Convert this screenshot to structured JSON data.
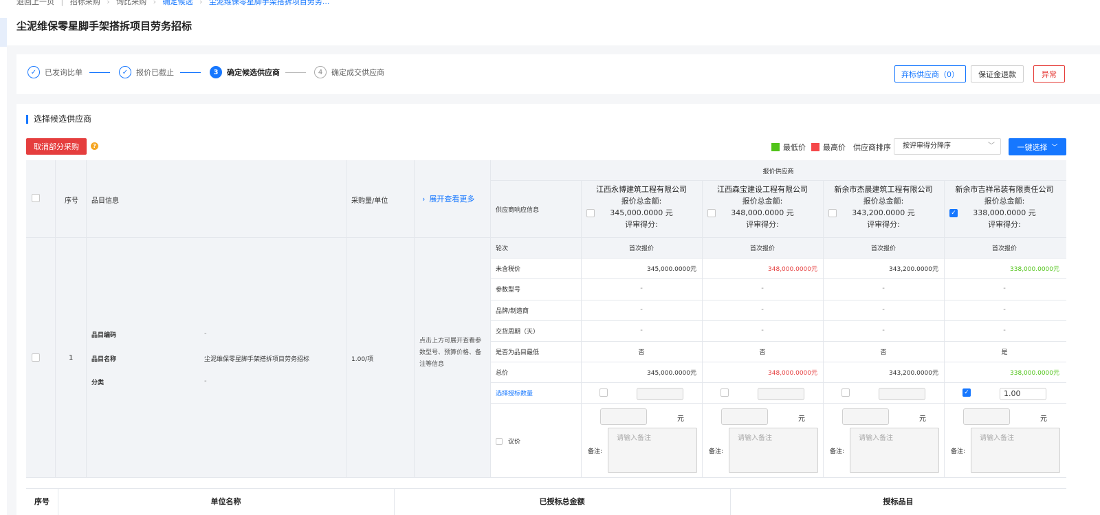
{
  "breadcrumb": {
    "back": "退回上一页",
    "items": [
      "招标采购",
      "询比采购",
      "确定候选"
    ],
    "current": "尘泥维保零星脚手架搭拆项目劳务..."
  },
  "page_title": "尘泥维保零星脚手架搭拆项目劳务招标",
  "steps": [
    {
      "num": "✓",
      "label": "已发询比单",
      "state": "done"
    },
    {
      "num": "✓",
      "label": "报价已截止",
      "state": "done"
    },
    {
      "num": "3",
      "label": "确定候选供应商",
      "state": "current"
    },
    {
      "num": "4",
      "label": "确定成交供应商",
      "state": "todo"
    }
  ],
  "top_buttons": {
    "abandon": "弃标供应商（0）",
    "deposit_refund": "保证金退款",
    "abnormal": "异常"
  },
  "section_title": "选择候选供应商",
  "cancel_partial": "取消部分采购",
  "legend": {
    "lowest": "最低价",
    "highest": "最高价",
    "sort_label": "供应商排序",
    "sort_value": "按评审得分降序",
    "low_color": "#52c41a",
    "high_color": "#f5484a"
  },
  "one_click": "一键选择",
  "table": {
    "headers": {
      "seq": "序号",
      "item_info": "品目信息",
      "qty_unit": "采购量/单位",
      "expand": "展开查看更多",
      "quote_suppliers": "报价供应商",
      "response_info": "供应商响应信息"
    },
    "suppliers": [
      {
        "name": "江西永博建筑工程有限公司",
        "total_label": "报价总金额:",
        "total": "345,000.0000 元",
        "score_label": "评审得分:",
        "checked": false,
        "round": "首次报价",
        "price": "345,000.0000元",
        "price_class": "",
        "param": "-",
        "brand": "-",
        "delivery": "-",
        "is_lowest": "否",
        "total_price": "345,000.0000元",
        "award_checked": false,
        "award_qty": "",
        "unit": "元",
        "remark_label": "备注:",
        "remark_ph": "请输入备注"
      },
      {
        "name": "江西森宝建设工程有限公司",
        "total_label": "报价总金额:",
        "total": "348,000.0000 元",
        "score_label": "评审得分:",
        "checked": false,
        "round": "首次报价",
        "price": "348,000.0000元",
        "price_class": "red",
        "param": "-",
        "brand": "-",
        "delivery": "-",
        "is_lowest": "否",
        "total_price": "348,000.0000元",
        "award_checked": false,
        "award_qty": "",
        "unit": "元",
        "remark_label": "备注:",
        "remark_ph": "请输入备注"
      },
      {
        "name": "新余市杰晨建筑工程有限公司",
        "total_label": "报价总金额:",
        "total": "343,200.0000 元",
        "score_label": "评审得分:",
        "checked": false,
        "round": "首次报价",
        "price": "343,200.0000元",
        "price_class": "",
        "param": "-",
        "brand": "-",
        "delivery": "-",
        "is_lowest": "否",
        "total_price": "343,200.0000元",
        "award_checked": false,
        "award_qty": "",
        "unit": "元",
        "remark_label": "备注:",
        "remark_ph": "请输入备注"
      },
      {
        "name": "新余市吉祥吊装有限责任公司",
        "total_label": "报价总金额:",
        "total": "338,000.0000 元",
        "score_label": "评审得分:",
        "checked": true,
        "round": "首次报价",
        "price": "338,000.0000元",
        "price_class": "green",
        "param": "-",
        "brand": "-",
        "delivery": "-",
        "is_lowest": "是",
        "total_price": "338,000.0000元",
        "award_checked": true,
        "award_qty": "1.00",
        "unit": "元",
        "remark_label": "备注:",
        "remark_ph": "请输入备注"
      }
    ],
    "row_labels": {
      "round": "轮次",
      "price": "未含税价",
      "param": "参数型号",
      "brand": "品牌/制造商",
      "delivery": "交货周期（天）",
      "is_lowest": "是否为品目最低",
      "total": "总价",
      "award_qty": "选择授标数量",
      "negotiate": "议价"
    },
    "row": {
      "seq": "1",
      "code_label": "品目编码",
      "code": "-",
      "name_label": "品目名称",
      "name": "尘泥维保零星脚手架搭拆项目劳务招标",
      "cat_label": "分类",
      "cat": "-",
      "qty": "1.00/项",
      "hint": "点击上方可展开查看参数型号、预算价格、备注等信息"
    }
  },
  "summary": {
    "seq": "序号",
    "unit_name": "单位名称",
    "total_awarded": "已授标总金额",
    "awarded_items": "授标品目"
  }
}
